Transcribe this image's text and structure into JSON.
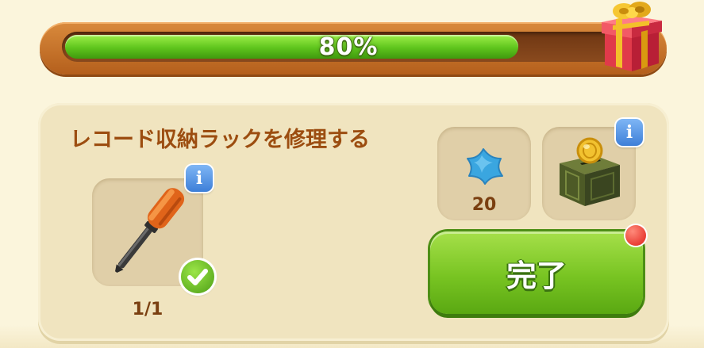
{
  "progress": {
    "percent": 80,
    "label": "80%",
    "fill_color": "#5ec41c",
    "reward_icon": "gift-box-icon"
  },
  "task": {
    "title": "レコード収納ラックを修理する",
    "tool": {
      "icon": "screwdriver-icon",
      "count_label": "1/1",
      "completed": true
    },
    "rewards": [
      {
        "icon": "blue-star-icon",
        "amount_label": "20"
      },
      {
        "icon": "coin-crate-icon",
        "amount_label": ""
      }
    ],
    "complete_button_label": "完了",
    "complete_button_color": "#78c422"
  }
}
